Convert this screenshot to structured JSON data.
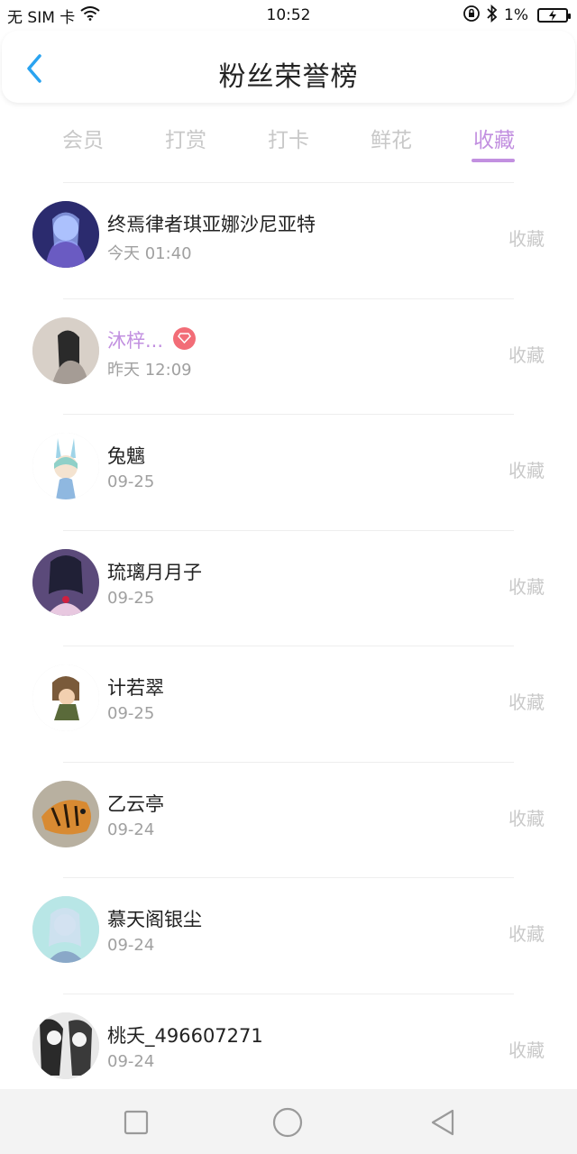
{
  "status_bar": {
    "carrier": "无 SIM 卡",
    "time": "10:52",
    "battery": "1%"
  },
  "header": {
    "title": "粉丝荣誉榜",
    "back_icon": "chevron-left-icon"
  },
  "tabs": [
    {
      "label": "会员",
      "active": false
    },
    {
      "label": "打赏",
      "active": false
    },
    {
      "label": "打卡",
      "active": false
    },
    {
      "label": "鲜花",
      "active": false
    },
    {
      "label": "收藏",
      "active": true
    }
  ],
  "accent_color": "#c290e0",
  "fans": [
    {
      "name": "终焉律者琪亚娜沙尼亚特",
      "time": "今天 01:40",
      "action": "收藏",
      "vip": false
    },
    {
      "name": "沐梓...",
      "time": "昨天 12:09",
      "action": "收藏",
      "vip": true
    },
    {
      "name": "兔魑",
      "time": "09-25",
      "action": "收藏",
      "vip": false
    },
    {
      "name": "琉璃月月子",
      "time": "09-25",
      "action": "收藏",
      "vip": false
    },
    {
      "name": "计若翠",
      "time": "09-25",
      "action": "收藏",
      "vip": false
    },
    {
      "name": "乙云亭",
      "time": "09-24",
      "action": "收藏",
      "vip": false
    },
    {
      "name": "慕天阁银尘",
      "time": "09-24",
      "action": "收藏",
      "vip": false
    },
    {
      "name": "桃夭_496607271",
      "time": "09-24",
      "action": "收藏",
      "vip": false
    }
  ],
  "nav_bar": {
    "icons": [
      "square-icon",
      "circle-icon",
      "back-triangle-icon"
    ]
  }
}
